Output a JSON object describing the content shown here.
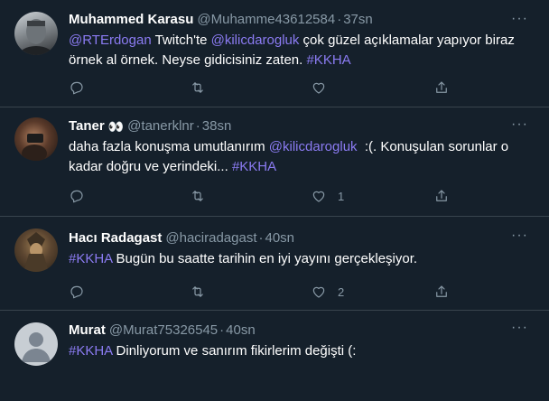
{
  "tweets": [
    {
      "name": "Muhammed Karasu",
      "handle": "@Muhamme43612584",
      "separator": "·",
      "time": "37sn",
      "text": [
        {
          "type": "mention",
          "value": "@RTErdogan"
        },
        {
          "type": "text",
          "value": " Twitch'te "
        },
        {
          "type": "mention",
          "value": "@kilicdarogluk"
        },
        {
          "type": "text",
          "value": " çok güzel açıklamalar yapıyor biraz örnek al örnek. Neyse gidicisiniz zaten. "
        },
        {
          "type": "hashtag",
          "value": "#KKHA"
        }
      ],
      "reply_count": "",
      "retweet_count": "",
      "like_count": ""
    },
    {
      "name": "Taner",
      "name_emoji": "👀",
      "handle": "@tanerklnr",
      "separator": "·",
      "time": "38sn",
      "text": [
        {
          "type": "text",
          "value": "daha fazla konuşma umutlanırım "
        },
        {
          "type": "mention",
          "value": "@kilicdarogluk"
        },
        {
          "type": "text",
          "value": "  :(. Konuşulan sorunlar o kadar doğru ve yerindeki... "
        },
        {
          "type": "hashtag",
          "value": "#KKHA"
        }
      ],
      "reply_count": "",
      "retweet_count": "",
      "like_count": "1"
    },
    {
      "name": "Hacı Radagast",
      "handle": "@haciradagast",
      "separator": "·",
      "time": "40sn",
      "text": [
        {
          "type": "hashtag",
          "value": "#KKHA"
        },
        {
          "type": "text",
          "value": " Bugün bu saatte tarihin en iyi yayını gerçekleşiyor."
        }
      ],
      "reply_count": "",
      "retweet_count": "",
      "like_count": "2"
    },
    {
      "name": "Murat",
      "handle": "@Murat75326545",
      "separator": "·",
      "time": "40sn",
      "text": [
        {
          "type": "hashtag",
          "value": "#KKHA"
        },
        {
          "type": "text",
          "value": " Dinliyorum ve sanırım fikirlerim değişti (:"
        }
      ],
      "reply_count": "",
      "retweet_count": "",
      "like_count": ""
    }
  ],
  "more_glyph": "···",
  "icons": {
    "reply": "reply-icon",
    "retweet": "retweet-icon",
    "like": "like-icon",
    "share": "share-icon",
    "more": "more-icon"
  },
  "colors": {
    "background": "#15202b",
    "divider": "#38444d",
    "secondary_text": "#8899a6",
    "link": "#8b7bf2"
  }
}
